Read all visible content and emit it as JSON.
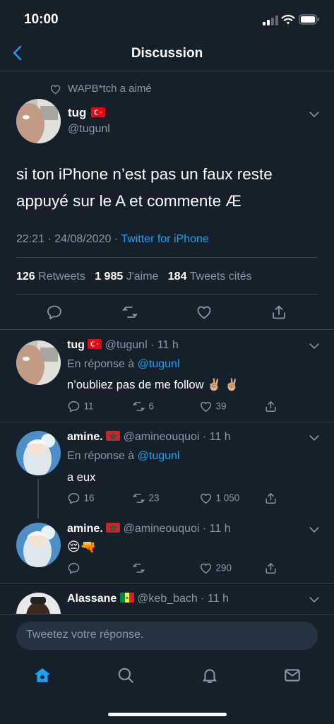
{
  "status_bar": {
    "time": "10:00"
  },
  "header": {
    "title": "Discussion"
  },
  "main_tweet": {
    "liked_by": "WAPB*tch a aimé",
    "name": "tug",
    "handle": "@tugunl",
    "text": "si ton iPhone n’est pas un faux reste appuyé sur le A et commente Æ",
    "time": "22:21",
    "date": "24/08/2020",
    "separator": "·",
    "source": "Twitter for iPhone",
    "retweets": "126",
    "retweets_label": "Retweets",
    "likes": "1 985",
    "likes_label": "J'aime",
    "quotes": "184",
    "quotes_label": "Tweets cités"
  },
  "replies": [
    {
      "name": "tug",
      "handle_time": "@tugunl · 11 h",
      "reply_to_label": "En réponse à",
      "reply_to": "@tugunl",
      "text": "n’oubliez pas de me follow ✌🏼 ✌🏼",
      "replies": "11",
      "retweets": "6",
      "likes": "39"
    },
    {
      "name": "amine.",
      "handle_time": "@amineouquoi · 11 h",
      "reply_to_label": "En réponse à",
      "reply_to": "@tugunl",
      "text": "a eux",
      "replies": "16",
      "retweets": "23",
      "likes": "1 050"
    },
    {
      "name": "amine.",
      "handle_time": "@amineouquoi · 11 h",
      "text": "😔🔫",
      "likes": "290"
    },
    {
      "name": "Alassane",
      "handle_time": "@keb_bach · 11 h"
    }
  ],
  "composer": {
    "placeholder": "Tweetez votre réponse."
  },
  "colors": {
    "background": "#15202b",
    "accent": "#1da1f2",
    "muted": "#8899a6",
    "divider": "#38444d"
  },
  "icons": [
    "back-chevron-icon",
    "heart-icon",
    "chevron-down-icon",
    "reply-icon",
    "retweet-icon",
    "share-icon",
    "home-icon",
    "search-icon",
    "notifications-icon",
    "messages-icon"
  ]
}
